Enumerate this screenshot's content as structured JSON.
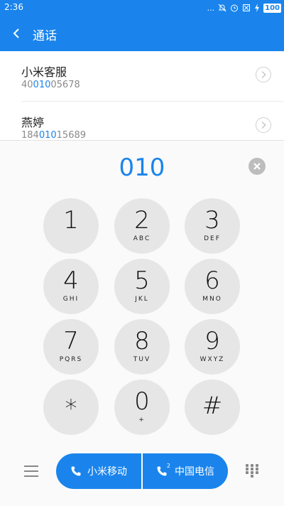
{
  "status_bar": {
    "time": "2:36",
    "dots": "...",
    "battery": "100"
  },
  "app_bar": {
    "title": "通话"
  },
  "contacts": [
    {
      "name": "小米客服",
      "number_pre": "40",
      "number_hl": "010",
      "number_post": "05678"
    },
    {
      "name": "燕婷",
      "number_pre": "184",
      "number_hl": "010",
      "number_post": "15689"
    }
  ],
  "dialpad": {
    "typed": "010",
    "keys": [
      {
        "digit": "1",
        "letters": ""
      },
      {
        "digit": "2",
        "letters": "ABC"
      },
      {
        "digit": "3",
        "letters": "DEF"
      },
      {
        "digit": "4",
        "letters": "GHI"
      },
      {
        "digit": "5",
        "letters": "JKL"
      },
      {
        "digit": "6",
        "letters": "MNO"
      },
      {
        "digit": "7",
        "letters": "PQRS"
      },
      {
        "digit": "8",
        "letters": "TUV"
      },
      {
        "digit": "9",
        "letters": "WXYZ"
      },
      {
        "digit": "*",
        "letters": ""
      },
      {
        "digit": "0",
        "letters": "+"
      },
      {
        "digit": "#",
        "letters": ""
      }
    ]
  },
  "bottom_bar": {
    "call_sim1": "小米移动",
    "call_sim2": "中国电信",
    "sim2_badge": "2"
  },
  "icons": [
    "back-icon",
    "clear-icon",
    "phone-icon",
    "menu-icon",
    "keypad-icon"
  ],
  "colors": {
    "accent": "#1a84ec",
    "key_bg": "#e6e6e6"
  }
}
